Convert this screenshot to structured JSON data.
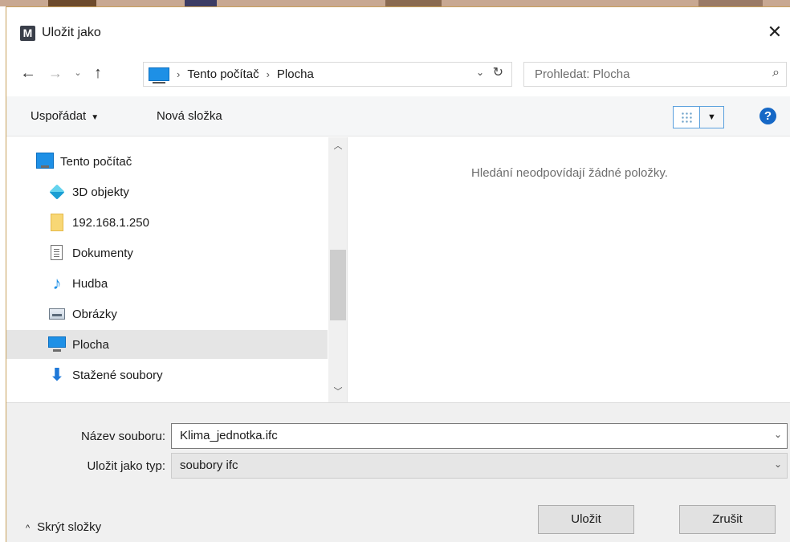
{
  "window": {
    "title": "Uložit jako",
    "app_icon_letter": "M",
    "close_glyph": "✕"
  },
  "nav": {
    "back_glyph": "←",
    "forward_glyph": "→",
    "recent_glyph": "⌄",
    "up_glyph": "↑",
    "breadcrumb": [
      "Tento počítač",
      "Plocha"
    ],
    "breadcrumb_separator": "›",
    "dropdown_glyph": "⌄",
    "refresh_glyph": "↻",
    "search_placeholder": "Prohledat: Plocha",
    "search_glyph": "⌕"
  },
  "toolbar": {
    "organize_label": "Uspořádat",
    "organize_caret": "▼",
    "new_folder_label": "Nová složka",
    "view_dropdown_glyph": "▼",
    "help_glyph": "?"
  },
  "tree": {
    "items": [
      {
        "label": "Tento počítač",
        "icon": "computer-icon"
      },
      {
        "label": "3D objekty",
        "icon": "3d-objects-icon"
      },
      {
        "label": "192.168.1.250",
        "icon": "folder-icon"
      },
      {
        "label": "Dokumenty",
        "icon": "documents-icon"
      },
      {
        "label": "Hudba",
        "icon": "music-icon"
      },
      {
        "label": "Obrázky",
        "icon": "pictures-icon"
      },
      {
        "label": "Plocha",
        "icon": "desktop-icon",
        "selected": true
      },
      {
        "label": "Stažené soubory",
        "icon": "downloads-icon"
      }
    ],
    "scroll_up_glyph": "︿",
    "scroll_down_glyph": "﹀",
    "music_glyph": "♪",
    "download_glyph": "⬇"
  },
  "content": {
    "empty_message": "Hledání neodpovídají žádné položky."
  },
  "form": {
    "filename_label": "Název souboru:",
    "filename_value": "Klima_jednotka.ifc",
    "filetype_label": "Uložit jako typ:",
    "filetype_value": "soubory ifc",
    "dropdown_glyph": "⌄"
  },
  "footer": {
    "hide_folders_label": "Skrýt složky",
    "hide_folders_glyph": "^",
    "save_label": "Uložit",
    "cancel_label": "Zrušit"
  },
  "colors": {
    "accent": "#1e90e6",
    "selection": "#e5e5e5",
    "help": "#1668c6"
  }
}
